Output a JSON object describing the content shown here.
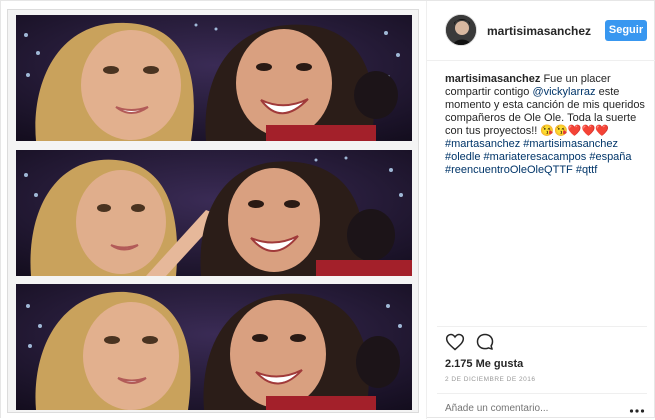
{
  "header": {
    "username": "martisimasanchez",
    "follow_label": "Seguir"
  },
  "caption": {
    "username": "martisimasanchez",
    "text_1": " Fue un placer compartir contigo ",
    "mention": "@vickylarraz",
    "text_2": " este momento y esta canción de mis queridos compañeros de Ole Ole. Toda la suerte con tus proyectos!! ",
    "emoji": "😘😘❤️❤️❤️",
    "hashtags": [
      "#martasanchez",
      "#martisimasanchez",
      "#oledle",
      "#mariateresacampos",
      "#españa",
      "#reencuentroOleOleQTTF",
      "#qttf"
    ]
  },
  "actions": {
    "like_icon": "heart-icon",
    "comment_icon": "comment-bubble-icon"
  },
  "likes": "2.175 Me gusta",
  "date": "2 DE DICIEMBRE DE 2016",
  "comment": {
    "placeholder": "Añade un comentario...",
    "more_icon": "more-dots-icon"
  },
  "colors": {
    "follow_button": "#3897f0",
    "link": "#003569"
  }
}
